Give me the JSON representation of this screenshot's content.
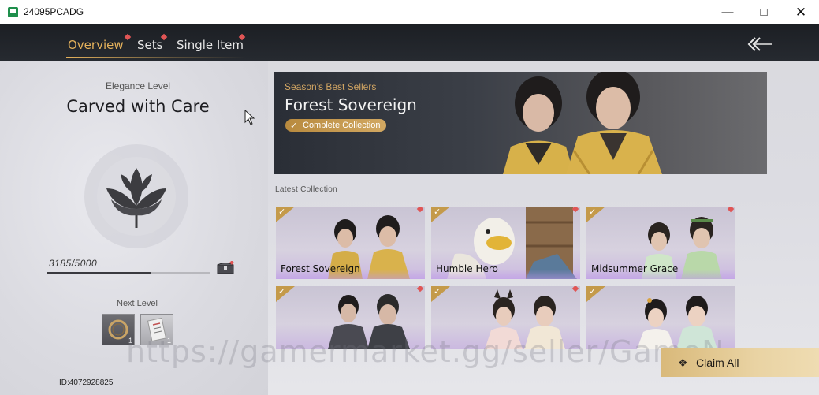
{
  "window": {
    "title": "24095PCADG"
  },
  "nav": {
    "tabs": [
      {
        "label": "Overview",
        "active": true
      },
      {
        "label": "Sets",
        "active": false
      },
      {
        "label": "Single Item",
        "active": false
      }
    ]
  },
  "left": {
    "elegance_label": "Elegance Level",
    "elegance_title": "Carved with Care",
    "progress_text": "3185/5000",
    "progress": {
      "current": 3185,
      "max": 5000
    },
    "next_level_label": "Next Level",
    "rewards": [
      {
        "icon": "ring-icon",
        "count": "1"
      },
      {
        "icon": "scroll-icon",
        "count": "1"
      }
    ],
    "id_text": "ID:4072928825"
  },
  "banner": {
    "subtitle": "Season's Best Sellers",
    "title": "Forest Sovereign",
    "pill": "Complete Collection"
  },
  "latest_label": "Latest Collection",
  "cards": [
    {
      "name": "Forest Sovereign"
    },
    {
      "name": "Humble Hero"
    },
    {
      "name": "Midsummer Grace"
    },
    {
      "name": ""
    },
    {
      "name": ""
    },
    {
      "name": ""
    }
  ],
  "claim": {
    "label": "Claim All"
  },
  "watermark": "https://gamermarket.gg/seller/GameN",
  "colors": {
    "accent_gold": "#e4b15b",
    "nav_bg": "#1c1f24",
    "badge_red": "#e05555"
  }
}
